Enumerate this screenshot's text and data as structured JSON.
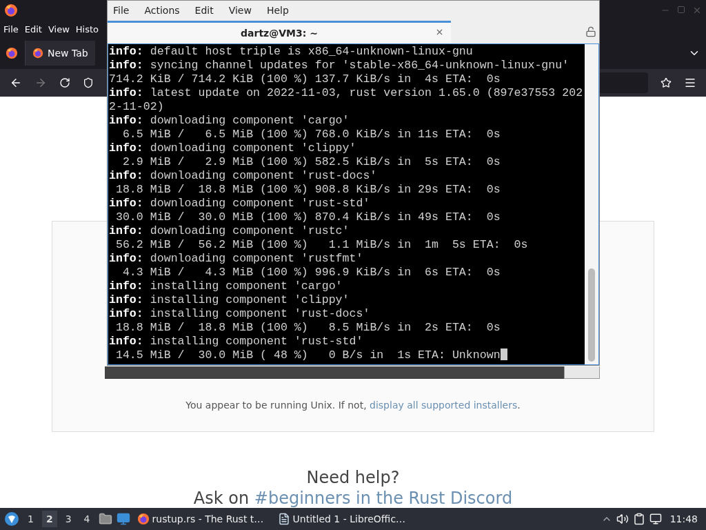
{
  "browser": {
    "menu": [
      "File",
      "Edit",
      "View",
      "Histo"
    ],
    "tabs": [
      {
        "label": "New Tab",
        "selected": true
      }
    ],
    "page": {
      "notice": "You appear to be running Unix. If not, ",
      "notice_link": "display all supported installers",
      "notice_end": ".",
      "help_title": "Need help?",
      "help_text": "Ask on ",
      "help_link": "#beginners in the Rust Discord"
    }
  },
  "terminal": {
    "menu": [
      "File",
      "Actions",
      "Edit",
      "View",
      "Help"
    ],
    "tab_title": "dartz@VM3: ~",
    "lines": [
      {
        "kind": "info",
        "label": "info:",
        "text": " default host triple is x86_64-unknown-linux-gnu"
      },
      {
        "kind": "info",
        "label": "info:",
        "text": " syncing channel updates for 'stable-x86_64-unknown-linux-gnu'"
      },
      {
        "kind": "plain",
        "text": "714.2 KiB / 714.2 KiB (100 %) 137.7 KiB/s in  4s ETA:  0s"
      },
      {
        "kind": "info",
        "label": "info:",
        "text": " latest update on 2022-11-03, rust version 1.65.0 (897e37553 202"
      },
      {
        "kind": "plain",
        "text": "2-11-02)"
      },
      {
        "kind": "info",
        "label": "info:",
        "text": " downloading component 'cargo'"
      },
      {
        "kind": "plain",
        "text": "  6.5 MiB /   6.5 MiB (100 %) 768.0 KiB/s in 11s ETA:  0s"
      },
      {
        "kind": "info",
        "label": "info:",
        "text": " downloading component 'clippy'"
      },
      {
        "kind": "plain",
        "text": "  2.9 MiB /   2.9 MiB (100 %) 582.5 KiB/s in  5s ETA:  0s"
      },
      {
        "kind": "info",
        "label": "info:",
        "text": " downloading component 'rust-docs'"
      },
      {
        "kind": "plain",
        "text": " 18.8 MiB /  18.8 MiB (100 %) 908.8 KiB/s in 29s ETA:  0s"
      },
      {
        "kind": "info",
        "label": "info:",
        "text": " downloading component 'rust-std'"
      },
      {
        "kind": "plain",
        "text": " 30.0 MiB /  30.0 MiB (100 %) 870.4 KiB/s in 49s ETA:  0s"
      },
      {
        "kind": "info",
        "label": "info:",
        "text": " downloading component 'rustc'"
      },
      {
        "kind": "plain",
        "text": " 56.2 MiB /  56.2 MiB (100 %)   1.1 MiB/s in  1m  5s ETA:  0s"
      },
      {
        "kind": "info",
        "label": "info:",
        "text": " downloading component 'rustfmt'"
      },
      {
        "kind": "plain",
        "text": "  4.3 MiB /   4.3 MiB (100 %) 996.9 KiB/s in  6s ETA:  0s"
      },
      {
        "kind": "info",
        "label": "info:",
        "text": " installing component 'cargo'"
      },
      {
        "kind": "info",
        "label": "info:",
        "text": " installing component 'clippy'"
      },
      {
        "kind": "info",
        "label": "info:",
        "text": " installing component 'rust-docs'"
      },
      {
        "kind": "plain",
        "text": " 18.8 MiB /  18.8 MiB (100 %)   8.5 MiB/s in  2s ETA:  0s"
      },
      {
        "kind": "info",
        "label": "info:",
        "text": " installing component 'rust-std'"
      },
      {
        "kind": "plain",
        "text": " 14.5 MiB /  30.0 MiB ( 48 %)   0 B/s in  1s ETA: Unknown",
        "cursor": true
      }
    ]
  },
  "taskbar": {
    "workspaces": [
      {
        "label": "1",
        "selected": false
      },
      {
        "label": "2",
        "selected": true
      },
      {
        "label": "3",
        "selected": false
      },
      {
        "label": "4",
        "selected": false
      }
    ],
    "tasks": [
      {
        "kind": "browser",
        "label": "rustup.rs - The Rust t…"
      },
      {
        "kind": "document",
        "label": "Untitled 1 - LibreOffic…"
      }
    ],
    "clock": "11:48"
  }
}
